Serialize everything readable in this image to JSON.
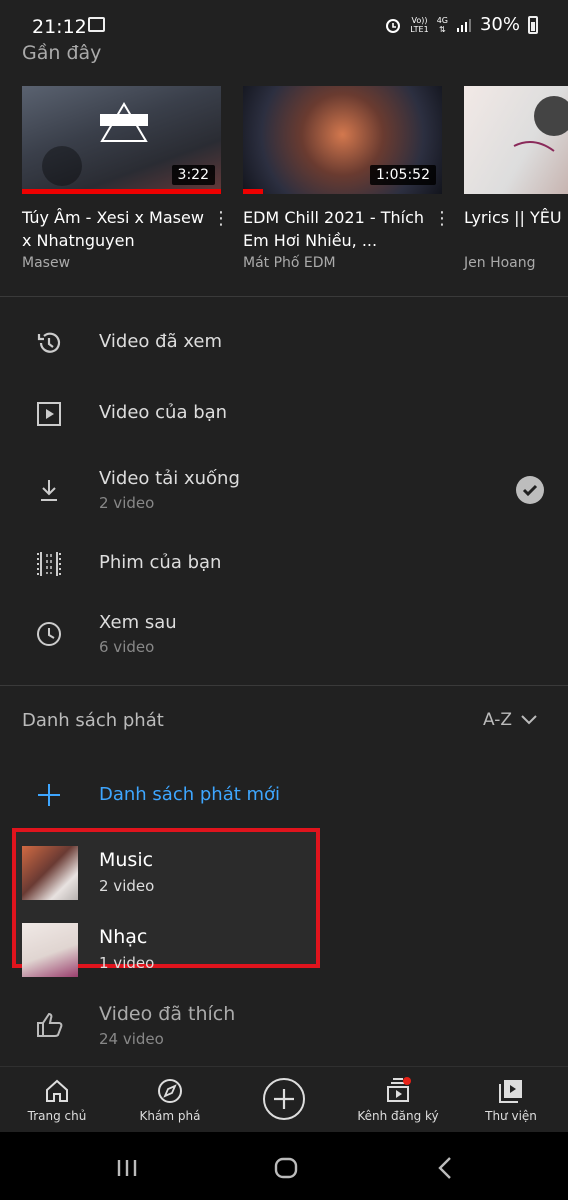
{
  "status_bar": {
    "time": "21:12",
    "network_top": "Vo))",
    "network_bottom": "LTE1",
    "signal": "4G",
    "battery": "30%"
  },
  "recent": {
    "title": "Gần đây",
    "videos": [
      {
        "title": "Túy Âm - Xesi x Masew x Nhatnguyen",
        "channel": "Masew",
        "duration": "3:22",
        "progress": 1.0
      },
      {
        "title": "EDM Chill 2021 - Thích Em Hơi Nhiều, ...",
        "channel": "Mát Phố EDM",
        "duration": "1:05:52",
        "progress": 0.1
      },
      {
        "title": "Lyrics || YÊU Rhymastic",
        "channel": "Jen Hoang",
        "duration": "",
        "progress": 0
      }
    ]
  },
  "library_menu": [
    {
      "label": "Video đã xem",
      "sub": "",
      "icon": "history-icon"
    },
    {
      "label": "Video của bạn",
      "sub": "",
      "icon": "play-box-icon"
    },
    {
      "label": "Video tải xuống",
      "sub": "2 video",
      "icon": "download-icon"
    },
    {
      "label": "Phim của bạn",
      "sub": "",
      "icon": "film-icon"
    },
    {
      "label": "Xem sau",
      "sub": "6 video",
      "icon": "clock-icon"
    }
  ],
  "playlists": {
    "header": "Danh sách phát",
    "sort_label": "A-Z",
    "new_playlist_label": "Danh sách phát mới",
    "items": [
      {
        "title": "Music",
        "sub": "2 video"
      },
      {
        "title": "Nhạc",
        "sub": "1 video"
      },
      {
        "title": "Video đã thích",
        "sub": "24 video"
      }
    ]
  },
  "bottom_nav": [
    {
      "label": "Trang chủ",
      "icon": "home-icon"
    },
    {
      "label": "Khám phá",
      "icon": "compass-icon"
    },
    {
      "label": "",
      "icon": "add-icon"
    },
    {
      "label": "Kênh đăng ký",
      "icon": "subscriptions-icon"
    },
    {
      "label": "Thư viện",
      "icon": "library-icon"
    }
  ],
  "colors": {
    "background": "#212121",
    "accent_red": "#e0141d",
    "link_blue": "#3ea6ff"
  }
}
